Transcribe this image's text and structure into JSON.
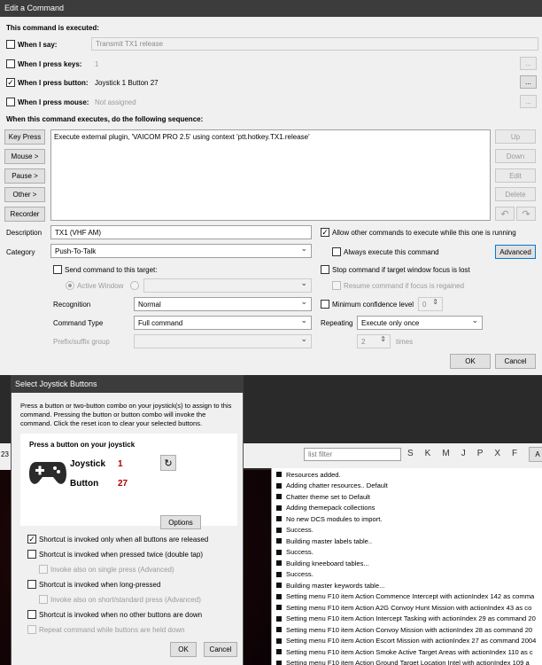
{
  "edit": {
    "title": "Edit a Command",
    "section1": "This command is executed:",
    "when_say": {
      "label": "When I say:",
      "value": "Transmit TX1 release"
    },
    "when_keys": {
      "label": "When I press keys:",
      "value": "1"
    },
    "when_button": {
      "label": "When I press button:",
      "value": "Joystick 1 Button 27"
    },
    "when_mouse": {
      "label": "When I press mouse:",
      "value": "Not assigned"
    },
    "browse": "...",
    "section2": "When this command executes, do the following sequence:",
    "side_buttons": [
      "Key Press",
      "Mouse >",
      "Pause >",
      "Other >",
      "Recorder"
    ],
    "action_text": "Execute external plugin, 'VAICOM PRO 2.5' using context 'ptt.hotkey.TX1.release'",
    "right_buttons": [
      "Up",
      "Down",
      "Edit",
      "Delete"
    ],
    "undo_icon": "undo-icon",
    "redo_icon": "redo-icon",
    "description": {
      "label": "Description",
      "value": "TX1 (VHF AM)"
    },
    "allow_other": "Allow other commands to execute while this one is running",
    "always_execute": "Always execute this command",
    "advanced": "Advanced",
    "category": {
      "label": "Category",
      "value": "Push-To-Talk"
    },
    "send_target": "Send command to this target:",
    "stop_focus": "Stop command if target window focus is lost",
    "active_window": "Active Window",
    "resume_focus": "Resume command if focus is regained",
    "recognition": {
      "label": "Recognition",
      "value": "Normal"
    },
    "min_conf": {
      "label": "Minimum confidence level",
      "value": "0"
    },
    "command_type": {
      "label": "Command Type",
      "value": "Full command"
    },
    "repeating": {
      "label": "Repeating",
      "value": "Execute only once"
    },
    "prefix_group": "Prefix/suffix group",
    "times": {
      "value": "2",
      "label": "times"
    },
    "ok": "OK",
    "cancel": "Cancel"
  },
  "joy": {
    "title": "Select Joystick Buttons",
    "instructions": "Press a button or two-button combo on your joystick(s) to assign to this command.  Pressing the button or button combo will invoke the command.  Click the reset icon to clear your selected buttons.",
    "press_label": "Press a button on your joystick",
    "joystick_label": "Joystick",
    "joystick_value": "1",
    "button_label": "Button",
    "button_value": "27",
    "gamepad_icon": "gamepad-icon",
    "reset_icon": "reset-icon",
    "options": "Options",
    "opt1": "Shortcut is invoked only when all buttons are released",
    "opt2": "Shortcut is invoked when pressed twice (double tap)",
    "opt2a": "Invoke also on single press (Advanced)",
    "opt3": "Shortcut is invoked when long-pressed",
    "opt3a": "Invoke also on short/standard press (Advanced)",
    "opt4": "Shortcut is invoked when no other buttons are down",
    "opt5": "Repeat command while buttons are held down",
    "ok": "OK",
    "cancel": "Cancel"
  },
  "bg": {
    "count_fragment": "23",
    "list_filter_placeholder": "list filter",
    "letters": [
      "S",
      "K",
      "M",
      "J",
      "P",
      "X",
      "F"
    ],
    "right_btn_fragment": "A",
    "log": [
      "Resources added.",
      "Adding chatter resources.. Default",
      "Chatter theme set to Default",
      "Adding themepack collections",
      "No new DCS modules to import.",
      "Success.",
      "Building master labels table..",
      "Success.",
      "Building kneeboard tables...",
      "Success.",
      "Building master keywords table...",
      "Setting menu F10 item Action Commence Intercept with actionIndex 142 as comma",
      "Setting menu F10 item Action  A2G Convoy Hunt Mission  with actionIndex 43 as co",
      "Setting menu F10 item Action Intercept Tasking with actionIndex 29 as command 20",
      "Setting menu F10 item Action Convoy Mission with actionIndex 28 as command 20",
      "Setting menu F10 item Action Escort Mission with actionIndex 27 as command 2004",
      "Setting menu F10 item Action  Smoke Active Target Areas  with actionIndex 110 as c",
      "Setting menu F10 item Action  Ground Target Location Intel  with actionIndex 109 a"
    ]
  }
}
